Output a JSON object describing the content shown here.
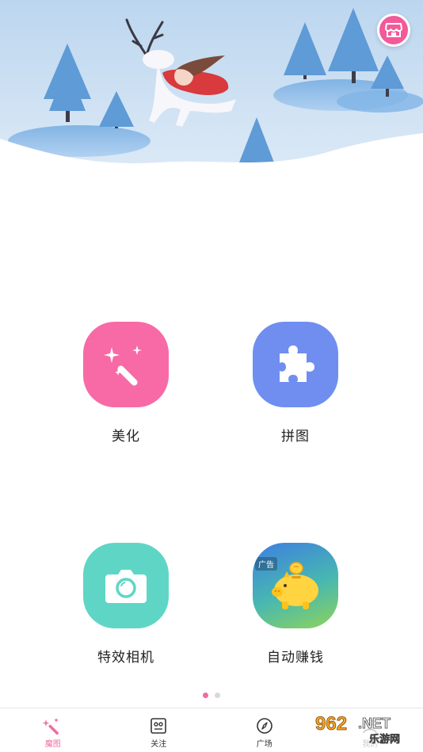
{
  "header": {
    "shop_icon": "store-icon"
  },
  "features": [
    {
      "label": "美化",
      "icon": "magic-wand-icon",
      "color": "#f76aa6"
    },
    {
      "label": "拼图",
      "icon": "puzzle-icon",
      "color": "#6f8ef0"
    },
    {
      "label": "特效相机",
      "icon": "camera-icon",
      "color": "#5fd6c5"
    },
    {
      "label": "自动赚钱",
      "icon": "piggy-bank-icon",
      "ad_tag": "广告"
    }
  ],
  "pager": {
    "pages": 2,
    "current": 1
  },
  "bottom_nav": {
    "items": [
      {
        "label": "魔图",
        "icon": "magic-wand-icon",
        "active": true
      },
      {
        "label": "关注",
        "icon": "follow-icon",
        "active": false
      },
      {
        "label": "广场",
        "icon": "compass-icon",
        "active": false
      },
      {
        "label": "我的",
        "icon": "profile-icon",
        "active": false
      }
    ]
  },
  "watermark": {
    "line1": "962.NET",
    "line2": "乐游网"
  },
  "colors": {
    "accent": "#f36aa2",
    "banner_sky": "#c8def2"
  }
}
